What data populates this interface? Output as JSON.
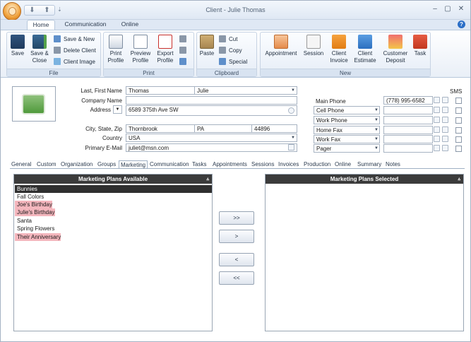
{
  "window": {
    "title": "Client - Julie Thomas",
    "minimize_glyph": "–",
    "restore_glyph": "▢",
    "close_glyph": "✕",
    "help_glyph": "?",
    "qat_down_glyph": "⬇",
    "qat_up_glyph": "⬆",
    "qat_more_glyph": "⇣"
  },
  "ribbon": {
    "tabs": [
      "Home",
      "Communication",
      "Online"
    ],
    "groups": {
      "file": {
        "label": "File",
        "save": "Save",
        "save_close_1": "Save &",
        "save_close_2": "Close",
        "save_new": "Save & New",
        "delete_client": "Delete Client",
        "client_image": "Client Image"
      },
      "print": {
        "label": "Print",
        "print_profile_1": "Print",
        "print_profile_2": "Profile",
        "preview_profile_1": "Preview",
        "preview_profile_2": "Profile",
        "export_profile_1": "Export",
        "export_profile_2": "Profile"
      },
      "clipboard": {
        "label": "Clipboard",
        "paste": "Paste",
        "cut": "Cut",
        "copy": "Copy",
        "special": "Special"
      },
      "new": {
        "label": "New",
        "appointment": "Appointment",
        "session": "Session",
        "client_invoice_1": "Client",
        "client_invoice_2": "Invoice",
        "client_estimate_1": "Client",
        "client_estimate_2": "Estimate",
        "customer_deposit_1": "Customer",
        "customer_deposit_2": "Deposit",
        "task": "Task"
      }
    }
  },
  "client": {
    "labels": {
      "name": "Last, First Name",
      "company": "Company Name",
      "address": "Address",
      "city_state_zip": "City, State, Zip",
      "country": "Country",
      "email": "Primary E-Mail"
    },
    "last_name": "Thomas",
    "first_name": "Julie",
    "company": "",
    "address": "6589 375th Ave SW",
    "city": "Thornbrook",
    "state": "PA",
    "zip": "44896",
    "country": "USA",
    "email": "juliet@msn.com"
  },
  "phones": {
    "sms_label": "SMS",
    "rows": [
      {
        "type": "Main Phone",
        "number": "(778) 995-6582"
      },
      {
        "type": "Cell Phone",
        "number": ""
      },
      {
        "type": "Work Phone",
        "number": ""
      },
      {
        "type": "Home Fax",
        "number": ""
      },
      {
        "type": "Work Fax",
        "number": ""
      },
      {
        "type": "Pager",
        "number": ""
      }
    ]
  },
  "nav_tabs": [
    "General",
    "Custom",
    "Organization",
    "Groups",
    "Marketing",
    "Communication",
    "Tasks",
    "Appointments",
    "Sessions",
    "Invoices",
    "Production",
    "Online",
    "Summary",
    "Notes"
  ],
  "marketing": {
    "available_title": "Marketing Plans Available",
    "selected_title": "Marketing Plans Selected",
    "caret": "▵",
    "available": [
      "Bunnies",
      "Fall Colors",
      "Joe's Birthday",
      "Julie's Birthday",
      "Santa",
      "Spring Flowers",
      "Their Anniversary"
    ],
    "selected": [],
    "buttons": [
      ">>",
      ">",
      "<",
      "<<"
    ]
  }
}
